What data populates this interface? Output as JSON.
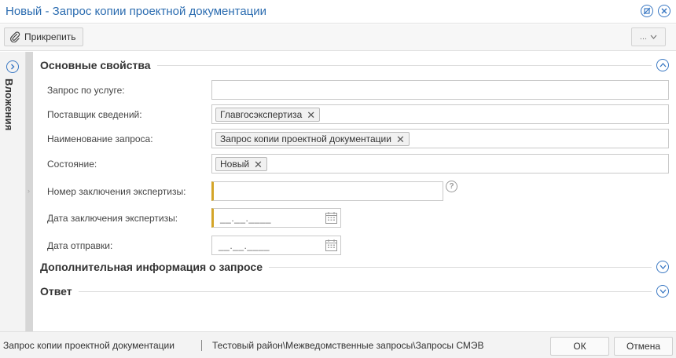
{
  "window": {
    "title": "Новый - Запрос копии проектной документации"
  },
  "toolbar": {
    "attach_label": "Прикрепить",
    "more_label": "..."
  },
  "side_panel": {
    "label": "Вложения"
  },
  "sections": {
    "main": "Основные свойства",
    "additional": "Дополнительная информация о запросе",
    "answer": "Ответ"
  },
  "fields": {
    "service_request": {
      "label": "Запрос по услуге:",
      "value": ""
    },
    "provider": {
      "label": "Поставщик сведений:",
      "tag": "Главгосэкспертиза"
    },
    "request_name": {
      "label": "Наименование запроса:",
      "tag": "Запрос копии проектной документации"
    },
    "state": {
      "label": "Состояние:",
      "tag": "Новый"
    },
    "conclusion_number": {
      "label": "Номер заключения экспертизы:",
      "value": ""
    },
    "conclusion_date": {
      "label": "Дата заключения экспертизы:",
      "mask": "__.__.____"
    },
    "send_date": {
      "label": "Дата отправки:",
      "mask": "__.__.____"
    }
  },
  "status": {
    "document": "Запрос копии проектной документации",
    "path": "Тестовый район\\Межведомственные запросы\\Запросы СМЭВ"
  },
  "footer": {
    "ok_label": "ОК",
    "cancel_label": "Отмена"
  },
  "colors": {
    "accent": "#3a78c3",
    "title": "#2b6cb0",
    "required_marker": "#d4a528"
  }
}
